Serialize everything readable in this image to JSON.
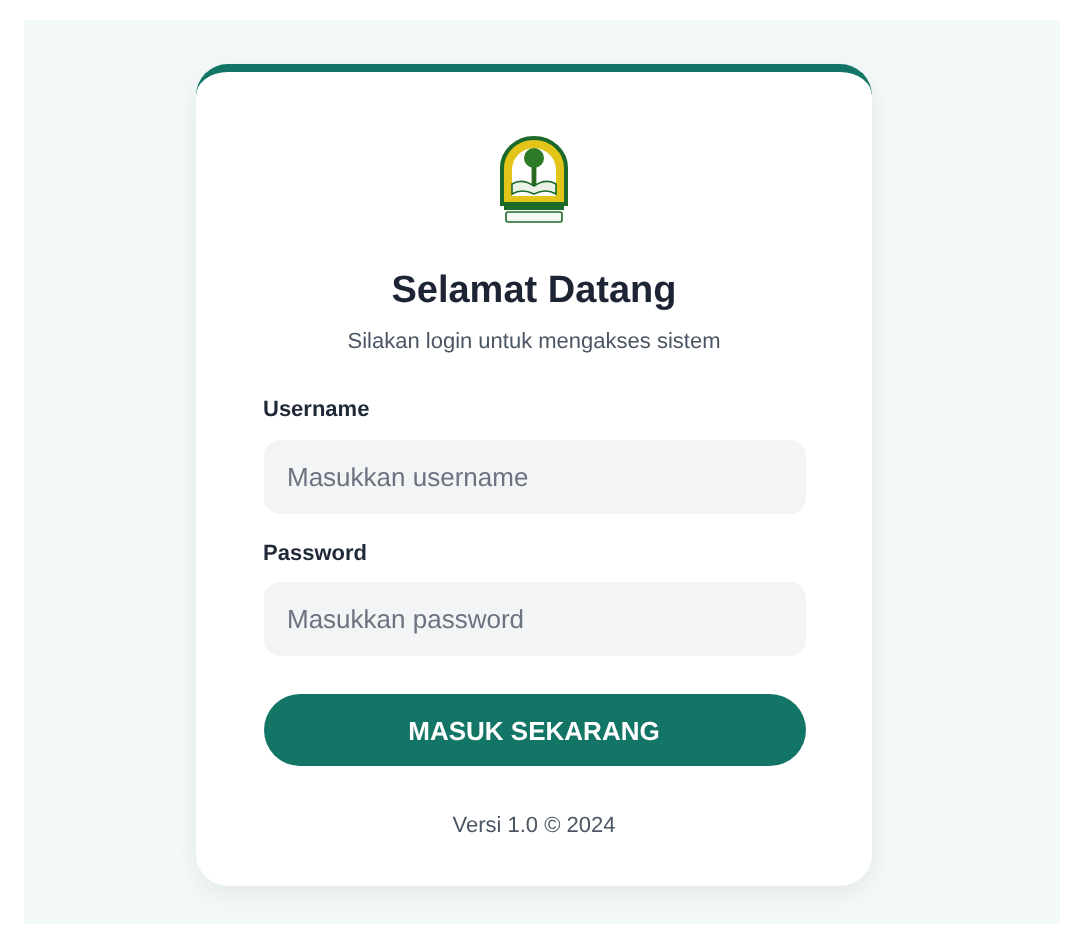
{
  "card": {
    "title": "Selamat Datang",
    "subtitle": "Silakan login untuk mengakses sistem"
  },
  "fields": [
    {
      "label": "Username",
      "placeholder": "Masukkan username"
    },
    {
      "label": "Password",
      "placeholder": "Masukkan password"
    }
  ],
  "button": "MASUK SEKARANG",
  "footer": "Versi 1.0 © 2024"
}
